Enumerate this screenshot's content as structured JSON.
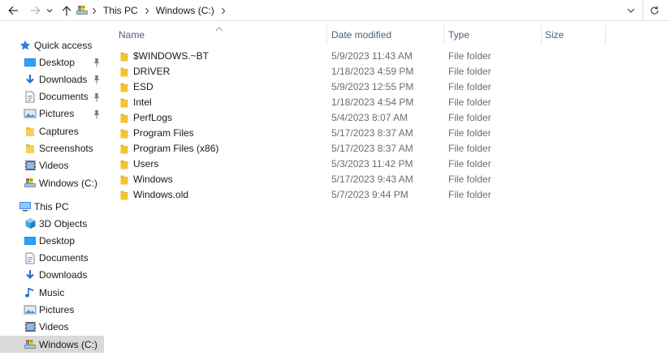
{
  "address_bar": {
    "crumbs": [
      "This PC",
      "Windows (C:)"
    ]
  },
  "nav_pane": {
    "quick_access": {
      "label": "Quick access",
      "items": [
        {
          "label": "Desktop",
          "icon": "desktop-icon",
          "pinned": true
        },
        {
          "label": "Downloads",
          "icon": "downloads-icon",
          "pinned": true
        },
        {
          "label": "Documents",
          "icon": "documents-icon",
          "pinned": true
        },
        {
          "label": "Pictures",
          "icon": "pictures-icon",
          "pinned": true
        },
        {
          "label": "Captures",
          "icon": "folder-icon",
          "pinned": false
        },
        {
          "label": "Screenshots",
          "icon": "folder-icon",
          "pinned": false
        },
        {
          "label": "Videos",
          "icon": "videos-icon",
          "pinned": false
        },
        {
          "label": "Windows (C:)",
          "icon": "drive-icon",
          "pinned": false
        }
      ]
    },
    "this_pc": {
      "label": "This PC",
      "items": [
        {
          "label": "3D Objects",
          "icon": "3d-objects-icon"
        },
        {
          "label": "Desktop",
          "icon": "desktop-icon"
        },
        {
          "label": "Documents",
          "icon": "documents-icon"
        },
        {
          "label": "Downloads",
          "icon": "downloads-icon"
        },
        {
          "label": "Music",
          "icon": "music-icon"
        },
        {
          "label": "Pictures",
          "icon": "pictures-icon"
        },
        {
          "label": "Videos",
          "icon": "videos-icon"
        },
        {
          "label": "Windows (C:)",
          "icon": "drive-icon",
          "selected": true
        }
      ]
    }
  },
  "columns": {
    "name": "Name",
    "date_modified": "Date modified",
    "type": "Type",
    "size": "Size"
  },
  "files": [
    {
      "name": "$WINDOWS.~BT",
      "date": "5/9/2023 11:43 AM",
      "type": "File folder"
    },
    {
      "name": "DRIVER",
      "date": "1/18/2023 4:59 PM",
      "type": "File folder"
    },
    {
      "name": "ESD",
      "date": "5/9/2023 12:55 PM",
      "type": "File folder"
    },
    {
      "name": "Intel",
      "date": "1/18/2023 4:54 PM",
      "type": "File folder"
    },
    {
      "name": "PerfLogs",
      "date": "5/4/2023 8:07 AM",
      "type": "File folder"
    },
    {
      "name": "Program Files",
      "date": "5/17/2023 8:37 AM",
      "type": "File folder"
    },
    {
      "name": "Program Files (x86)",
      "date": "5/17/2023 8:37 AM",
      "type": "File folder"
    },
    {
      "name": "Users",
      "date": "5/3/2023 11:42 PM",
      "type": "File folder"
    },
    {
      "name": "Windows",
      "date": "5/17/2023 9:43 AM",
      "type": "File folder"
    },
    {
      "name": "Windows.old",
      "date": "5/7/2023 9:44 PM",
      "type": "File folder"
    }
  ],
  "colors": {
    "folder": "#f4c430",
    "selection": "#d9d9d9",
    "header_text": "#4c607a",
    "accent_blue": "#1e88e5"
  }
}
